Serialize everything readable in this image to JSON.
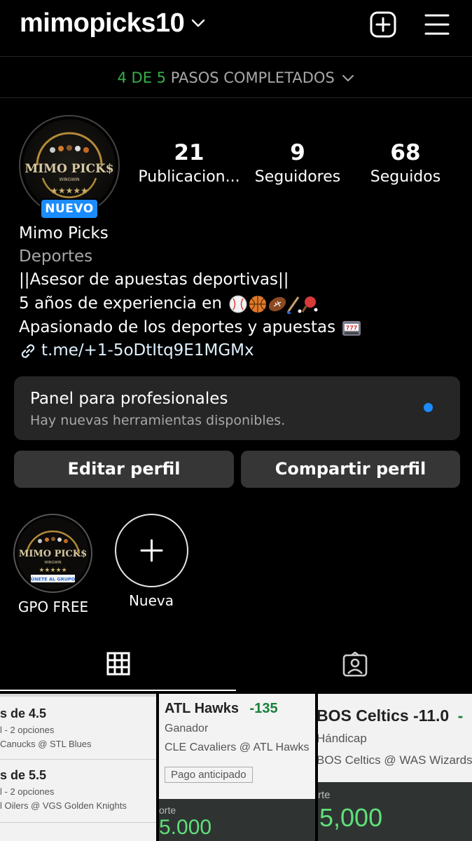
{
  "header": {
    "username": "mimopicks10",
    "add_icon": "plus-square-icon",
    "menu_icon": "hamburger-menu-icon"
  },
  "steps": {
    "progress": "4 DE 5",
    "label": "PASOS COMPLETADOS",
    "completed": 4,
    "total": 5
  },
  "profile": {
    "avatar_text": "MIMO PICK$",
    "avatar_subtext": "WINGWIN",
    "badge": "NUEVO",
    "stats": [
      {
        "value": "21",
        "label": "Publicacion..."
      },
      {
        "value": "9",
        "label": "Seguidores"
      },
      {
        "value": "68",
        "label": "Seguidos"
      }
    ],
    "name": "Mimo Picks",
    "category": "Deportes",
    "bio_lines": [
      "||Asesor de apuestas deportivas||",
      "5 años de experiencia en",
      "Apasionado de los deportes y apuestas"
    ],
    "link": "t.me/+1-5oDtItq9E1MGMx"
  },
  "panel": {
    "title": "Panel para profesionales",
    "subtitle": "Hay nuevas herramientas disponibles."
  },
  "buttons": {
    "edit": "Editar perfil",
    "share": "Compartir perfil"
  },
  "highlights": [
    {
      "label": "GPO FREE",
      "inner_text": "MIMO PICK$",
      "inner_sub": "WINGWIN",
      "inner_banner": "ÚNETE AL GRUPO"
    },
    {
      "label": "Nueva"
    }
  ],
  "tabs": [
    {
      "icon": "grid-icon",
      "active": true
    },
    {
      "icon": "tagged-person-icon",
      "active": false
    }
  ],
  "posts": [
    {
      "line1_title": "s de 4.5",
      "line1_sub": "l - 2 opciones",
      "line1_match": "Canucks @ STL Blues",
      "line2_title": "s de 5.5",
      "line2_sub": "l - 2 opciones",
      "line2_match": "l Oilers @ VGS Golden Knights"
    },
    {
      "team": "ATL Hawks",
      "odds": "-135",
      "market": "Ganador",
      "match": "CLE Cavaliers @ ATL Hawks",
      "tag": "Pago anticipado",
      "stake_label": "orte",
      "stake": "5.000"
    },
    {
      "team": "BOS Celtics -11.0",
      "odds": "-",
      "market": "Hándicap",
      "match": "BOS Celtics @ WAS Wizards",
      "stake_label": "rte",
      "stake": "5,000"
    }
  ]
}
